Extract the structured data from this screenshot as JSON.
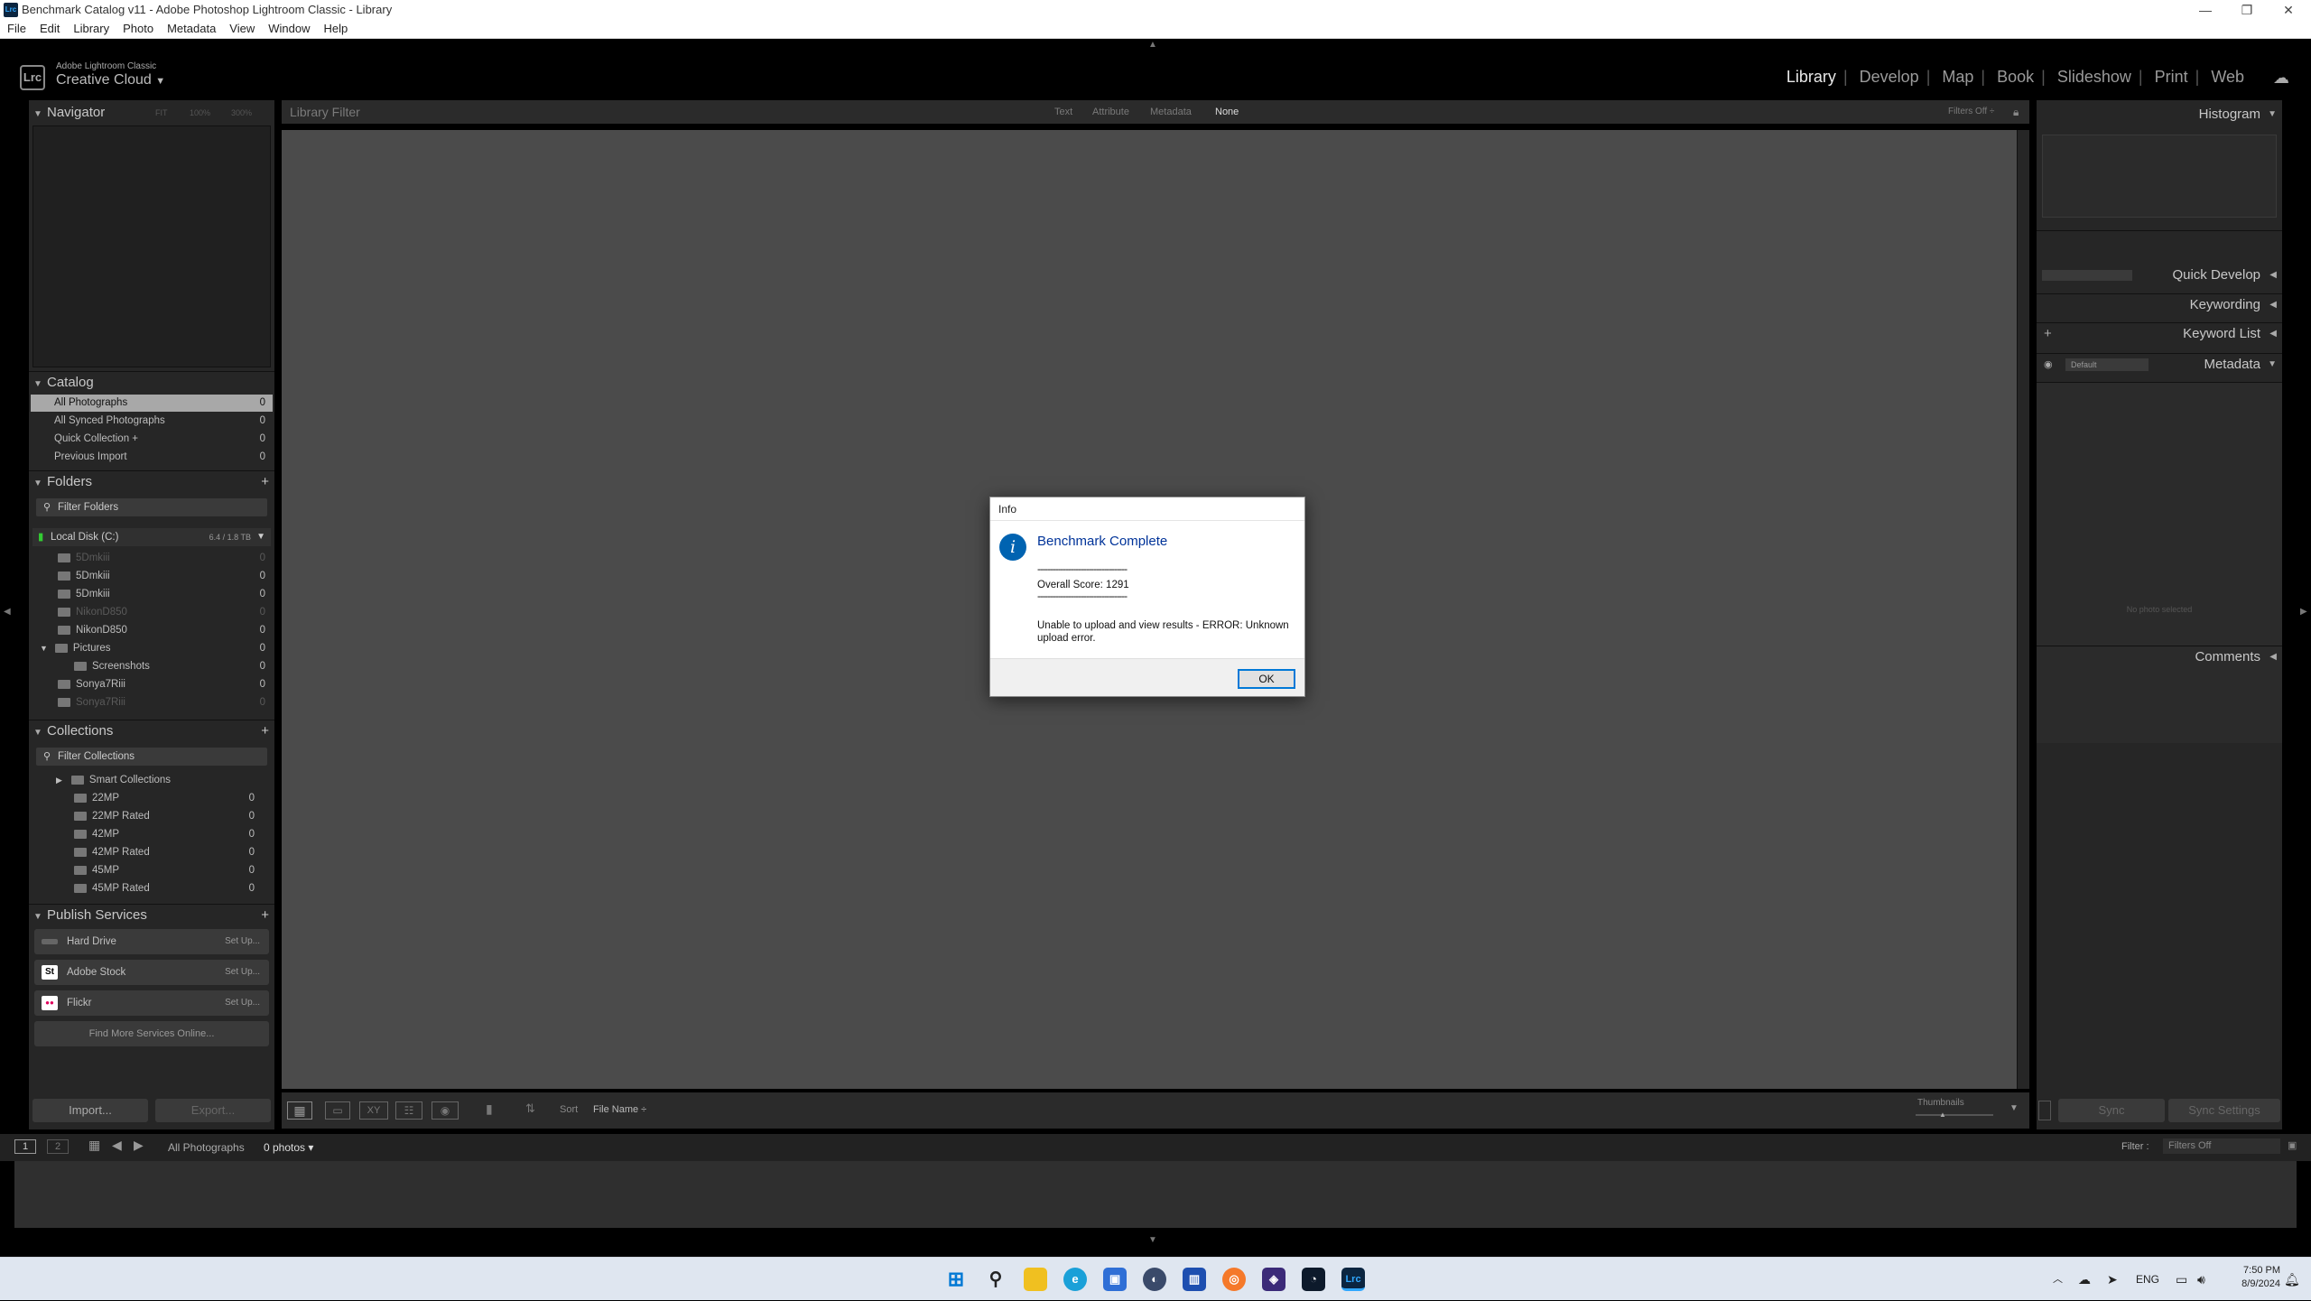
{
  "window": {
    "title": "Benchmark Catalog v11 - Adobe Photoshop Lightroom Classic - Library",
    "app_icon": "Lrc"
  },
  "menu": [
    "File",
    "Edit",
    "Library",
    "Photo",
    "Metadata",
    "View",
    "Window",
    "Help"
  ],
  "identity": {
    "logo": "Lrc",
    "line1": "Adobe Lightroom Classic",
    "line2": "Creative Cloud"
  },
  "modules": [
    {
      "label": "Library",
      "active": true
    },
    {
      "label": "Develop"
    },
    {
      "label": "Map"
    },
    {
      "label": "Book"
    },
    {
      "label": "Slideshow"
    },
    {
      "label": "Print"
    },
    {
      "label": "Web"
    }
  ],
  "left": {
    "navigator": {
      "title": "Navigator",
      "zoom": [
        "FIT",
        "100%",
        "300%"
      ]
    },
    "catalog": {
      "title": "Catalog",
      "items": [
        {
          "label": "All Photographs",
          "count": "0"
        },
        {
          "label": "All Synced Photographs",
          "count": "0"
        },
        {
          "label": "Quick Collection +",
          "count": "0"
        },
        {
          "label": "Previous Import",
          "count": "0"
        }
      ]
    },
    "folders": {
      "title": "Folders",
      "plus": "+",
      "filter": "Filter Folders",
      "disk": {
        "label": "Local Disk (C:)",
        "size": "6.4 / 1.8 TB"
      },
      "items": [
        {
          "label": "5Dmkiii",
          "count": "0"
        },
        {
          "label": "5Dmkiii",
          "count": "0"
        },
        {
          "label": "5Dmkiii",
          "count": "0"
        },
        {
          "label": "NikonD850",
          "count": "0"
        },
        {
          "label": "NikonD850",
          "count": "0"
        },
        {
          "label": "Pictures",
          "count": "0"
        },
        {
          "label": "Screenshots",
          "count": "0"
        },
        {
          "label": "Sonya7Riii",
          "count": "0"
        },
        {
          "label": "Sonya7Riii",
          "count": "0"
        }
      ]
    },
    "collections": {
      "title": "Collections",
      "plus": "+",
      "filter": "Filter Collections",
      "items": [
        {
          "label": "Smart Collections",
          "count": ""
        },
        {
          "label": "22MP",
          "count": "0"
        },
        {
          "label": "22MP Rated",
          "count": "0"
        },
        {
          "label": "42MP",
          "count": "0"
        },
        {
          "label": "42MP Rated",
          "count": "0"
        },
        {
          "label": "45MP",
          "count": "0"
        },
        {
          "label": "45MP Rated",
          "count": "0"
        }
      ]
    },
    "publish": {
      "title": "Publish Services",
      "plus": "+",
      "items": [
        {
          "label": "Hard Drive",
          "setup": "Set Up...",
          "icon": ""
        },
        {
          "label": "Adobe Stock",
          "setup": "Set Up...",
          "icon": "St"
        },
        {
          "label": "Flickr",
          "setup": "Set Up...",
          "icon": "●●"
        }
      ],
      "find_more": "Find More Services Online..."
    },
    "import": "Import...",
    "export": "Export..."
  },
  "center": {
    "filter": {
      "title": "Library Filter",
      "modes": [
        "Text",
        "Attribute",
        "Metadata",
        "None"
      ],
      "filters_off": "Filters Off ÷"
    },
    "toolbar": {
      "sort_label": "Sort",
      "sort_value": "File Name",
      "thumbnails": "Thumbnails"
    }
  },
  "right": {
    "histogram": "Histogram",
    "quick_develop": "Quick Develop",
    "keywording": "Keywording",
    "keyword_list": "Keyword List",
    "metadata": "Metadata",
    "metadata_preset": "Default",
    "no_photo": "No photo selected",
    "comments": "Comments",
    "sync": "Sync",
    "sync_settings": "Sync Settings"
  },
  "filmstrip": {
    "page1": "1",
    "page2": "2",
    "source": "All Photographs",
    "count": "0 photos",
    "filter_label": "Filter :",
    "filter_value": "Filters Off"
  },
  "dialog": {
    "title": "Info",
    "heading": "Benchmark Complete",
    "dashes": "-----------------------------------",
    "score": "Overall Score: 1291",
    "error1": "Unable to upload and view results - ERROR: Unknown",
    "error2": "upload error.",
    "ok": "OK"
  },
  "taskbar": {
    "lang": "ENG",
    "time": "7:50 PM",
    "date": "8/9/2024"
  }
}
